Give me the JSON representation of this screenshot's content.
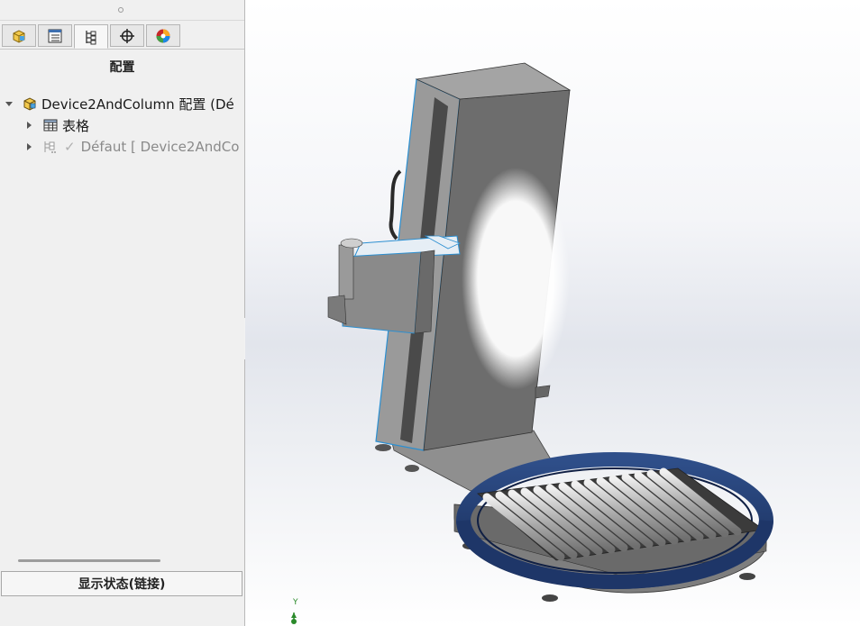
{
  "panel": {
    "title": "配置",
    "tabs": [
      {
        "name": "feature-manager",
        "icon": "part-icon"
      },
      {
        "name": "property-manager",
        "icon": "property-list-icon"
      },
      {
        "name": "configuration-manager",
        "icon": "configuration-icon"
      },
      {
        "name": "dimxpert",
        "icon": "crosshair-icon"
      },
      {
        "name": "display-manager",
        "icon": "appearance-icon"
      }
    ],
    "tree": {
      "root": "Device2AndColumn 配置  (Dé",
      "tables": "表格",
      "config": "Défaut [ Device2AndCo"
    },
    "display_state_button": "显示状态(链接)"
  },
  "viewport": {
    "triad_axis": "Y",
    "accent": "#1f3a6e",
    "edge_color": "#2b8fd1"
  }
}
